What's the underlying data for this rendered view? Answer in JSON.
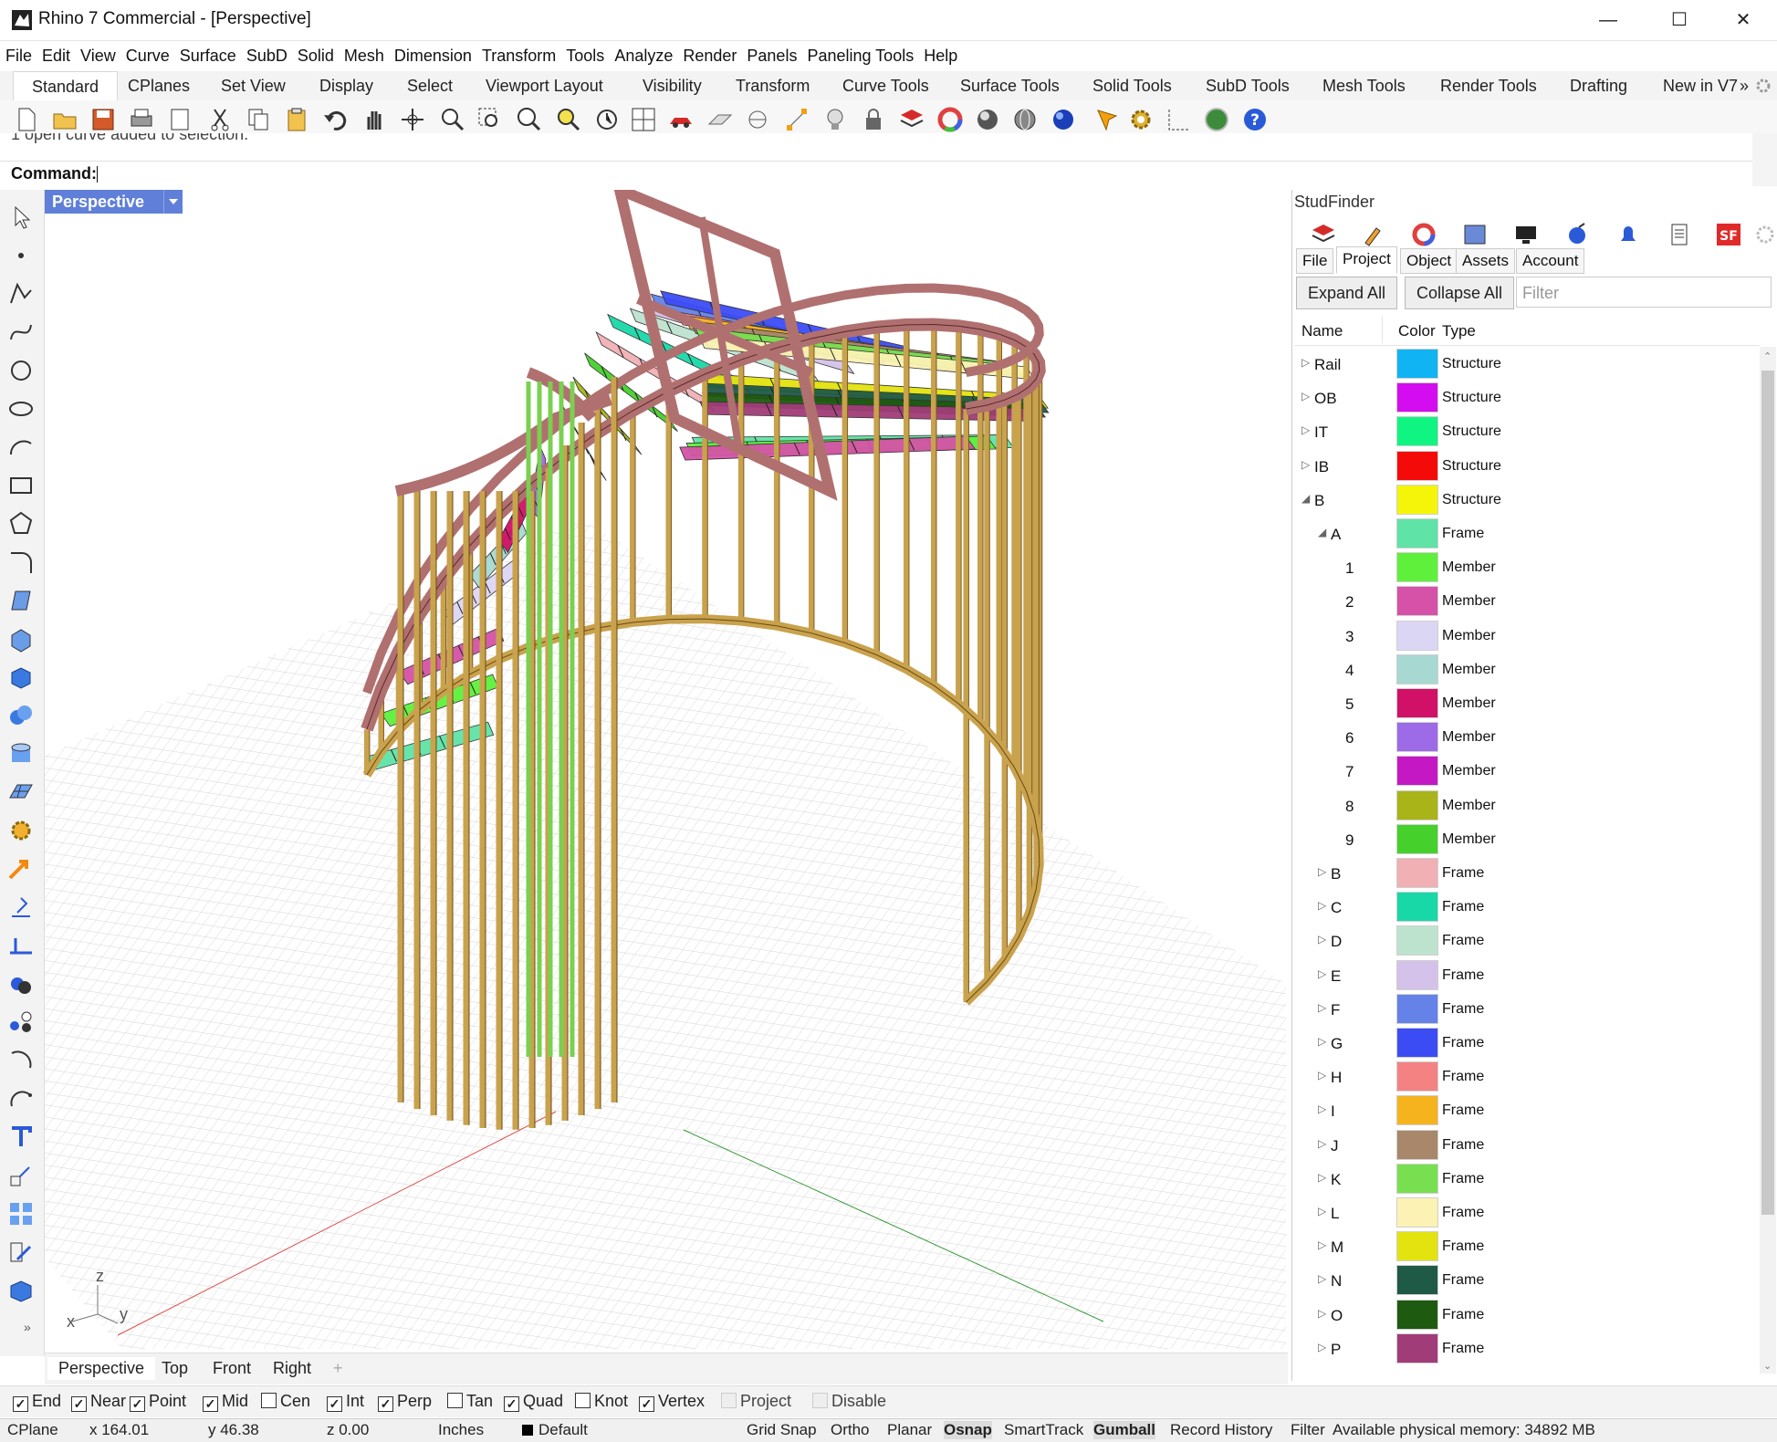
{
  "window": {
    "title": "Rhino 7 Commercial - [Perspective]",
    "controls": {
      "minimize": "—",
      "maximize": "☐",
      "close": "✕"
    }
  },
  "menu": [
    "File",
    "Edit",
    "View",
    "Curve",
    "Surface",
    "SubD",
    "Solid",
    "Mesh",
    "Dimension",
    "Transform",
    "Tools",
    "Analyze",
    "Render",
    "Panels",
    "Paneling Tools",
    "Help"
  ],
  "toolbar_tabs": [
    "Standard",
    "CPlanes",
    "Set View",
    "Display",
    "Select",
    "Viewport Layout",
    "Visibility",
    "Transform",
    "Curve Tools",
    "Surface Tools",
    "Solid Tools",
    "SubD Tools",
    "Mesh Tools",
    "Render Tools",
    "Drafting",
    "New in V7"
  ],
  "toolbar_tabs_overflow": "»",
  "command": {
    "history": "1 open curve added to selection.",
    "prompt": "Command:"
  },
  "viewport": {
    "title": "Perspective",
    "axis_labels": {
      "z": "z",
      "x": "x",
      "y": "y"
    },
    "tabs": [
      "Perspective",
      "Top",
      "Front",
      "Right"
    ],
    "add_tab": "+",
    "colors": {
      "header": "#5f7fd8",
      "grid": "#e8e8e8",
      "frame": "#b07070",
      "stud": "#c9a24e"
    }
  },
  "panel": {
    "title": "StudFinder",
    "tabs": [
      "File",
      "Project",
      "Object",
      "Assets",
      "Account"
    ],
    "active_tab": "Project",
    "buttons": {
      "expand": "Expand All",
      "collapse": "Collapse All"
    },
    "filter_placeholder": "Filter",
    "columns": {
      "name": "Name",
      "color": "Color",
      "type": "Type"
    },
    "rows": [
      {
        "name": "Rail",
        "level": 0,
        "expander": "▷",
        "color": "#10b4f2",
        "type": "Structure"
      },
      {
        "name": "OB",
        "level": 0,
        "expander": "▷",
        "color": "#d40df0",
        "type": "Structure"
      },
      {
        "name": "IT",
        "level": 0,
        "expander": "▷",
        "color": "#10f582",
        "type": "Structure"
      },
      {
        "name": "IB",
        "level": 0,
        "expander": "▷",
        "color": "#f50a0a",
        "type": "Structure"
      },
      {
        "name": "B",
        "level": 0,
        "expander": "◢",
        "color": "#f5f50a",
        "type": "Structure"
      },
      {
        "name": "A",
        "level": 1,
        "expander": "◢",
        "color": "#5fe3a6",
        "type": "Frame"
      },
      {
        "name": "1",
        "level": 2,
        "expander": "",
        "color": "#5ef03b",
        "type": "Member"
      },
      {
        "name": "2",
        "level": 2,
        "expander": "",
        "color": "#d552a8",
        "type": "Member"
      },
      {
        "name": "3",
        "level": 2,
        "expander": "",
        "color": "#dcd6f5",
        "type": "Member"
      },
      {
        "name": "4",
        "level": 2,
        "expander": "",
        "color": "#a8d8d2",
        "type": "Member"
      },
      {
        "name": "5",
        "level": 2,
        "expander": "",
        "color": "#d11068",
        "type": "Member"
      },
      {
        "name": "6",
        "level": 2,
        "expander": "",
        "color": "#9d6ae8",
        "type": "Member"
      },
      {
        "name": "7",
        "level": 2,
        "expander": "",
        "color": "#c418c4",
        "type": "Member"
      },
      {
        "name": "8",
        "level": 2,
        "expander": "",
        "color": "#a8b418",
        "type": "Member"
      },
      {
        "name": "9",
        "level": 2,
        "expander": "",
        "color": "#46d02c",
        "type": "Member"
      },
      {
        "name": "B",
        "level": 1,
        "expander": "▷",
        "color": "#f0b0b4",
        "type": "Frame"
      },
      {
        "name": "C",
        "level": 1,
        "expander": "▷",
        "color": "#18d8a8",
        "type": "Frame"
      },
      {
        "name": "D",
        "level": 1,
        "expander": "▷",
        "color": "#bde3cf",
        "type": "Frame"
      },
      {
        "name": "E",
        "level": 1,
        "expander": "▷",
        "color": "#d4c2ea",
        "type": "Frame"
      },
      {
        "name": "F",
        "level": 1,
        "expander": "▷",
        "color": "#6482e8",
        "type": "Frame"
      },
      {
        "name": "G",
        "level": 1,
        "expander": "▷",
        "color": "#3c4cf5",
        "type": "Frame"
      },
      {
        "name": "H",
        "level": 1,
        "expander": "▷",
        "color": "#f58282",
        "type": "Frame"
      },
      {
        "name": "I",
        "level": 1,
        "expander": "▷",
        "color": "#f5b41e",
        "type": "Frame"
      },
      {
        "name": "J",
        "level": 1,
        "expander": "▷",
        "color": "#a8876a",
        "type": "Frame"
      },
      {
        "name": "K",
        "level": 1,
        "expander": "▷",
        "color": "#78e050",
        "type": "Frame"
      },
      {
        "name": "L",
        "level": 1,
        "expander": "▷",
        "color": "#fbf2b4",
        "type": "Frame"
      },
      {
        "name": "M",
        "level": 1,
        "expander": "▷",
        "color": "#e3e30f",
        "type": "Frame"
      },
      {
        "name": "N",
        "level": 1,
        "expander": "▷",
        "color": "#1e5a46",
        "type": "Frame"
      },
      {
        "name": "O",
        "level": 1,
        "expander": "▷",
        "color": "#1e5a0f",
        "type": "Frame"
      },
      {
        "name": "P",
        "level": 1,
        "expander": "▷",
        "color": "#a03c78",
        "type": "Frame"
      }
    ]
  },
  "osnaps": [
    {
      "label": "End",
      "checked": true,
      "enabled": true
    },
    {
      "label": "Near",
      "checked": true,
      "enabled": true
    },
    {
      "label": "Point",
      "checked": true,
      "enabled": true
    },
    {
      "label": "Mid",
      "checked": true,
      "enabled": true
    },
    {
      "label": "Cen",
      "checked": false,
      "enabled": true
    },
    {
      "label": "Int",
      "checked": true,
      "enabled": true
    },
    {
      "label": "Perp",
      "checked": true,
      "enabled": true
    },
    {
      "label": "Tan",
      "checked": false,
      "enabled": true
    },
    {
      "label": "Quad",
      "checked": true,
      "enabled": true
    },
    {
      "label": "Knot",
      "checked": false,
      "enabled": true
    },
    {
      "label": "Vertex",
      "checked": true,
      "enabled": true
    },
    {
      "label": "Project",
      "checked": false,
      "enabled": false
    },
    {
      "label": "Disable",
      "checked": false,
      "enabled": false
    }
  ],
  "status": {
    "cplane": "CPlane",
    "x": "x 164.01",
    "y": "y 46.38",
    "z": "z 0.00",
    "units": "Inches",
    "layer": "Default",
    "toggles": [
      "Grid Snap",
      "Ortho",
      "Planar",
      "Osnap",
      "SmartTrack",
      "Gumball",
      "Record History",
      "Filter"
    ],
    "memory": "Available physical memory: 34892 MB"
  }
}
